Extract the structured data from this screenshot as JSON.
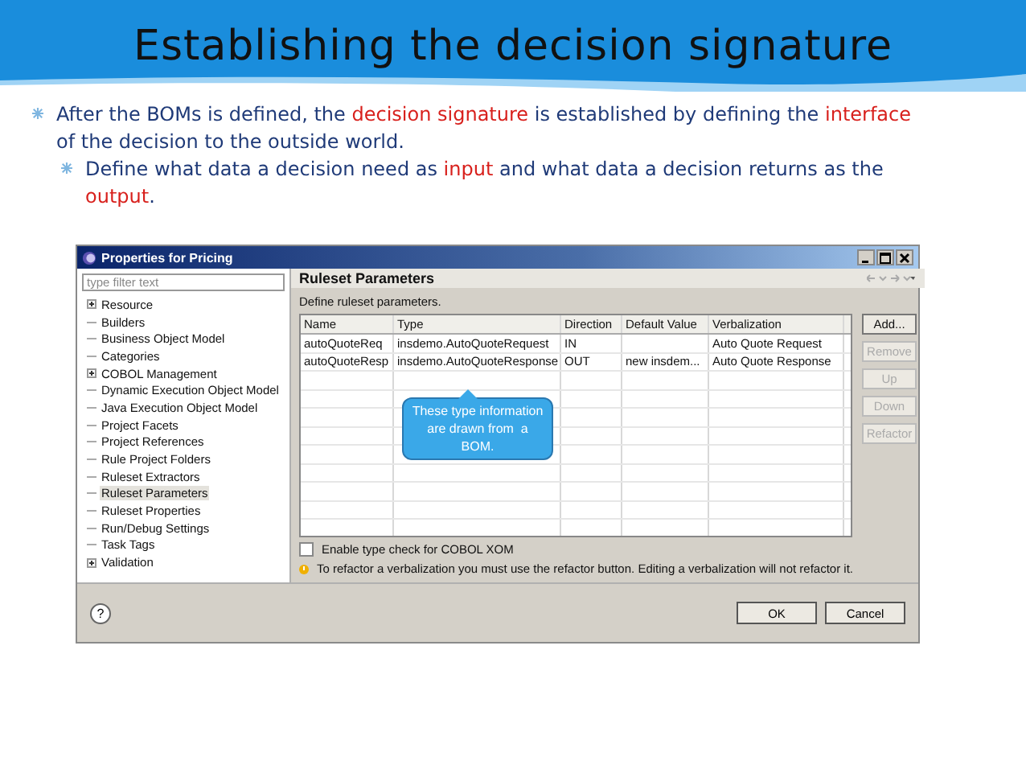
{
  "slide": {
    "title": "Establishing the decision signature",
    "bullets": [
      {
        "segments": [
          {
            "text": "After the BOMs is defined, the ",
            "emphasis": false
          },
          {
            "text": "decision signature",
            "emphasis": true
          },
          {
            "text": " is established by defining the ",
            "emphasis": false
          },
          {
            "text": "interface",
            "emphasis": true
          },
          {
            "text": " of the decision to the outside world.",
            "emphasis": false
          }
        ],
        "children": [
          {
            "segments": [
              {
                "text": "Define what data a decision need as ",
                "emphasis": false
              },
              {
                "text": "input",
                "emphasis": true
              },
              {
                "text": " and what data a decision returns as the ",
                "emphasis": false
              },
              {
                "text": "output",
                "emphasis": true
              },
              {
                "text": ".",
                "emphasis": false
              }
            ]
          }
        ]
      }
    ]
  },
  "window": {
    "title": "Properties for Pricing"
  },
  "sidebar": {
    "filter_placeholder": "type filter text",
    "items": [
      {
        "label": "Resource",
        "expandable": true,
        "selected": false
      },
      {
        "label": "Builders",
        "expandable": false,
        "selected": false
      },
      {
        "label": "Business Object Model",
        "expandable": false,
        "selected": false
      },
      {
        "label": "Categories",
        "expandable": false,
        "selected": false
      },
      {
        "label": "COBOL Management",
        "expandable": true,
        "selected": false
      },
      {
        "label": "Dynamic Execution Object Model",
        "expandable": false,
        "selected": false
      },
      {
        "label": "Java Execution Object Model",
        "expandable": false,
        "selected": false
      },
      {
        "label": "Project Facets",
        "expandable": false,
        "selected": false
      },
      {
        "label": "Project References",
        "expandable": false,
        "selected": false
      },
      {
        "label": "Rule Project Folders",
        "expandable": false,
        "selected": false
      },
      {
        "label": "Ruleset Extractors",
        "expandable": false,
        "selected": false
      },
      {
        "label": "Ruleset Parameters",
        "expandable": false,
        "selected": true
      },
      {
        "label": "Ruleset Properties",
        "expandable": false,
        "selected": false
      },
      {
        "label": "Run/Debug Settings",
        "expandable": false,
        "selected": false
      },
      {
        "label": "Task Tags",
        "expandable": false,
        "selected": false
      },
      {
        "label": "Validation",
        "expandable": true,
        "selected": false
      }
    ]
  },
  "page": {
    "title": "Ruleset Parameters",
    "description": "Define ruleset parameters.",
    "table": {
      "columns": [
        "Name",
        "Type",
        "Direction",
        "Default Value",
        "Verbalization"
      ],
      "rows": [
        [
          "autoQuoteReq",
          "insdemo.AutoQuoteRequest",
          "IN",
          "",
          "Auto Quote Request"
        ],
        [
          "autoQuoteResp",
          "insdemo.AutoQuoteResponse",
          "OUT",
          "new insdem...",
          "Auto Quote Response"
        ]
      ]
    },
    "buttons": [
      {
        "label": "Add...",
        "disabled": false
      },
      {
        "label": "Remove",
        "disabled": true
      },
      {
        "label": "Up",
        "disabled": true
      },
      {
        "label": "Down",
        "disabled": true
      },
      {
        "label": "Refactor",
        "disabled": true
      }
    ],
    "checkbox": {
      "label": "Enable type check for COBOL XOM",
      "checked": false
    },
    "warning": "To refactor a verbalization you must use the refactor button. Editing a verbalization will not refactor it."
  },
  "callout": "These type information are drawn from  a BOM.",
  "footer": {
    "help": "?",
    "buttons": [
      "OK",
      "Cancel"
    ]
  }
}
